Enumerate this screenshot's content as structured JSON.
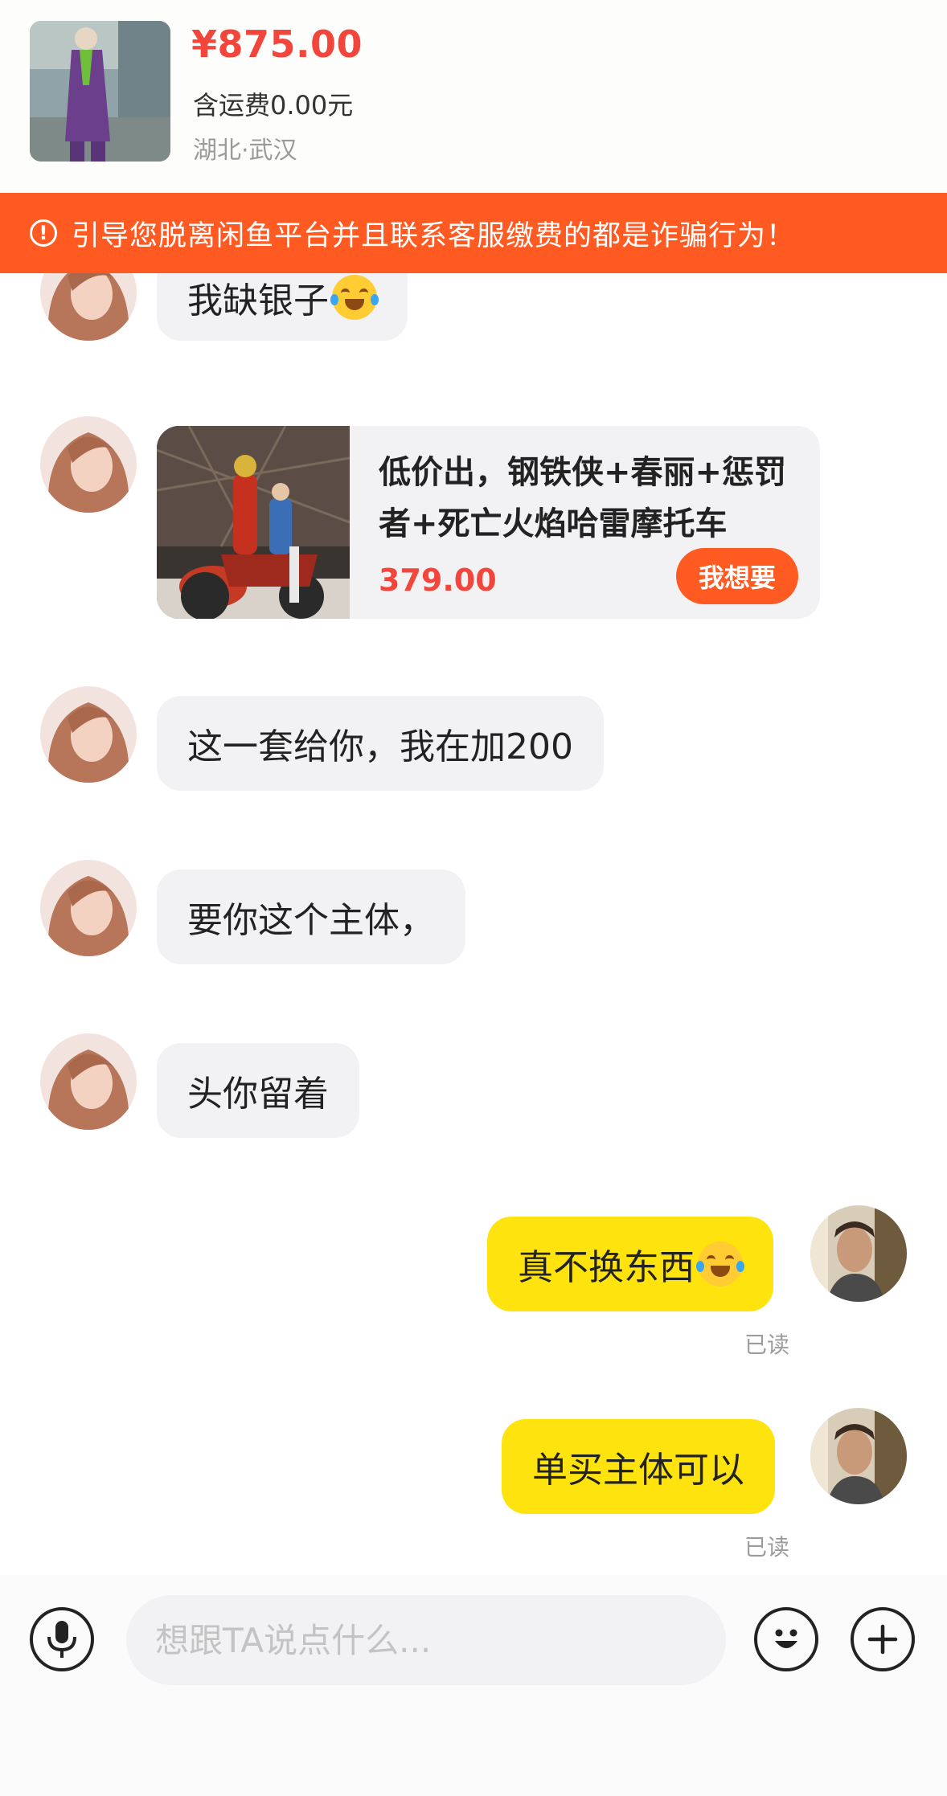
{
  "product": {
    "price": "¥875.00",
    "shipping": "含运费0.00元",
    "location": "湖北·武汉"
  },
  "warning": {
    "icon": "exclamation-circle-icon",
    "text": "引导您脱离闲鱼平台并且联系客服缴费的都是诈骗行为！"
  },
  "messages": {
    "m1": {
      "text": "我缺银子",
      "emoji": "tears-of-joy-emoji"
    },
    "card": {
      "title": "低价出，钢铁侠+春丽+惩罚者+死亡火焰哈雷摩托车",
      "price": "379.00",
      "button": "我想要"
    },
    "m2": {
      "text": "这一套给你，我在加200"
    },
    "m3": {
      "text": "要你这个主体，"
    },
    "m4": {
      "text": "头你留着"
    },
    "m5": {
      "text": "真不换东西",
      "emoji": "loudly-crying-emoji",
      "status": "已读"
    },
    "m6": {
      "text": "单买主体可以",
      "status": "已读"
    }
  },
  "composer": {
    "placeholder": "想跟TA说点什么...",
    "icons": [
      "microphone-icon",
      "smiley-icon",
      "plus-icon"
    ]
  },
  "colors": {
    "accent": "#ff5a22",
    "price": "#f2463c",
    "self_bubble": "#ffe30f",
    "other_bubble": "#f2f2f4"
  }
}
